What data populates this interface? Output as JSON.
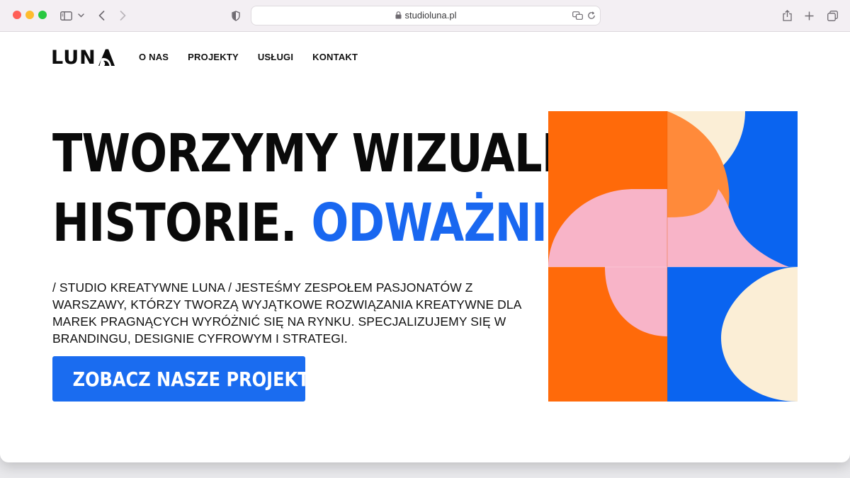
{
  "browser": {
    "url": "studioluna.pl",
    "icons": [
      "sidebar-icon",
      "chevron-down-icon",
      "back-icon",
      "forward-icon",
      "shield-icon",
      "lock-icon",
      "translate-icon",
      "reload-icon",
      "share-icon",
      "plus-icon",
      "tabs-icon"
    ]
  },
  "site": {
    "logo": "LUNA",
    "nav": [
      "O NAS",
      "PROJEKTY",
      "USŁUGI",
      "KONTAKT"
    ],
    "hero": {
      "line1": "TWORZYMY WIZUALNE",
      "line2_plain": "HISTORIE. ",
      "line2_accent": "ODWAŻNIE."
    },
    "description": "/ STUDIO KREATYWNE LUNA / JESTEŚMY ZESPOŁEM PASJONATÓW Z WARSZAWY, KTÓRZY TWORZĄ WYJĄTKOWE ROZWIĄZANIA KREATYWNE DLA MAREK PRAGNĄCYCH WYRÓŻNIĆ SIĘ NA RYNKU. SPECJALIZUJEMY SIĘ W BRANDINGU, DESIGNIE CYFROWYM I STRATEGI.",
    "cta": "ZOBACZ NASZE PROJEKTY"
  },
  "colors": {
    "accent": "#1a6cf0",
    "orange": "#ff6a0a",
    "light_orange": "#ff8a3a",
    "pink": "#f8b4c8",
    "blue": "#0a64f0",
    "cream": "#fbeed6"
  }
}
